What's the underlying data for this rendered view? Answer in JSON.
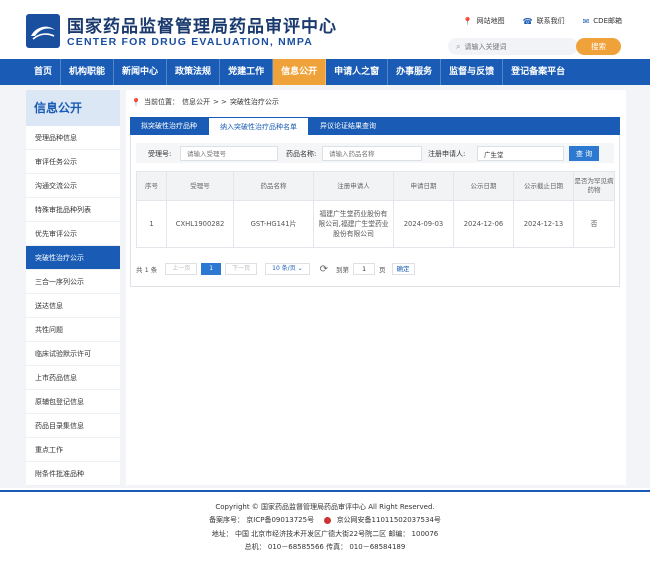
{
  "header": {
    "title_cn": "国家药品监督管理局药品审评中心",
    "title_en": "CENTER FOR DRUG EVALUATION, NMPA",
    "links": [
      {
        "icon": "map-pin-icon",
        "label": "网站地图"
      },
      {
        "icon": "phone-icon",
        "label": "联系我们"
      },
      {
        "icon": "mail-icon",
        "label": "CDE邮箱"
      }
    ],
    "search_placeholder": "请输入关键词",
    "search_button": "搜索"
  },
  "nav": {
    "items": [
      "首页",
      "机构职能",
      "新闻中心",
      "政策法规",
      "党建工作",
      "信息公开",
      "申请人之窗",
      "办事服务",
      "监督与反馈",
      "登记备案平台"
    ],
    "active": "信息公开"
  },
  "sidebar": {
    "title": "信息公开",
    "items": [
      "受理品种信息",
      "审评任务公示",
      "沟通交流公示",
      "特殊审批品种列表",
      "优先审评公示",
      "突破性治疗公示",
      "三合一序列公示",
      "送达信息",
      "共性问题",
      "临床试验默示许可",
      "上市药品信息",
      "原辅包登记信息",
      "药品目录集信息",
      "重点工作",
      "附条件批准品种"
    ],
    "active": "突破性治疗公示"
  },
  "breadcrumb": {
    "prefix": "当前位置：",
    "section": "信息公开",
    "separator": " > > ",
    "current": "突破性治疗公示"
  },
  "tabs": {
    "items": [
      "拟突破性治疗品种",
      "纳入突破性治疗品种名单",
      "异议论证结果查询"
    ],
    "active": "纳入突破性治疗品种名单"
  },
  "filter": {
    "accept_label": "受理号:",
    "accept_placeholder": "请输入受理号",
    "drug_label": "药品名称:",
    "drug_placeholder": "请输入药品名称",
    "applicant_label": "注册申请人:",
    "applicant_value": "广生堂",
    "query_button": "查 询"
  },
  "table": {
    "headers": [
      "序号",
      "受理号",
      "药品名称",
      "注册申请人",
      "申请日期",
      "公示日期",
      "公示截止日期",
      "是否为罕见病药物"
    ],
    "rows": [
      {
        "no": "1",
        "accept_no": "CXHL1900282",
        "drug": "GST-HG141片",
        "applicant": "福建广生堂药业股份有限公司,福建广生堂药业股份有限公司",
        "apply_date": "2024-09-03",
        "publish_date": "2024-12-06",
        "deadline": "2024-12-13",
        "rare": "否"
      }
    ]
  },
  "pager": {
    "total": "共 1 条",
    "prev": "上一页",
    "page": "1",
    "next": "下一页",
    "page_size": "10 条/页",
    "goto_label": "到第",
    "goto_value": "1",
    "page_unit": "页",
    "confirm": "确定"
  },
  "footer": {
    "copyright": "Copyright © 国家药品监督管理局药品审评中心   All Right Reserved.",
    "icp": "备案序号：  京ICP备09013725号",
    "police": "京公网安备11011502037534号",
    "address": "地址：  中国  北京市经济技术开发区广德大街22号院二区     邮编：  100076",
    "phone": "总机：  010－68585566      传真：  010－68584189"
  },
  "colors": {
    "primary": "#1a5cb5",
    "accent": "#f0a23a"
  }
}
